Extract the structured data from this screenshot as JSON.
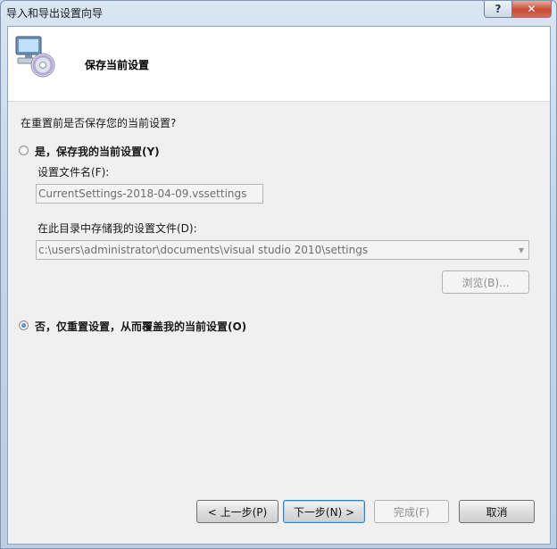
{
  "window": {
    "title": "导入和导出设置向导",
    "help_label": "?",
    "close_label": "✕"
  },
  "banner": {
    "title": "保存当前设置",
    "icon": "computer-disc-icon"
  },
  "question": "在重置前是否保存您的当前设置?",
  "option_save": {
    "label": "是，保存我的当前设置(Y)",
    "selected": false,
    "filename_label": "设置文件名(F):",
    "filename_value": "CurrentSettings-2018-04-09.vssettings",
    "directory_label": "在此目录中存储我的设置文件(D):",
    "directory_value": "c:\\users\\administrator\\documents\\visual studio 2010\\settings",
    "browse_label": "浏览(B)..."
  },
  "option_overwrite": {
    "label": "否，仅重置设置，从而覆盖我的当前设置(O)",
    "selected": true
  },
  "buttons": {
    "back": "< 上一步(P)",
    "next": "下一步(N) >",
    "finish": "完成(F)",
    "cancel": "取消"
  }
}
